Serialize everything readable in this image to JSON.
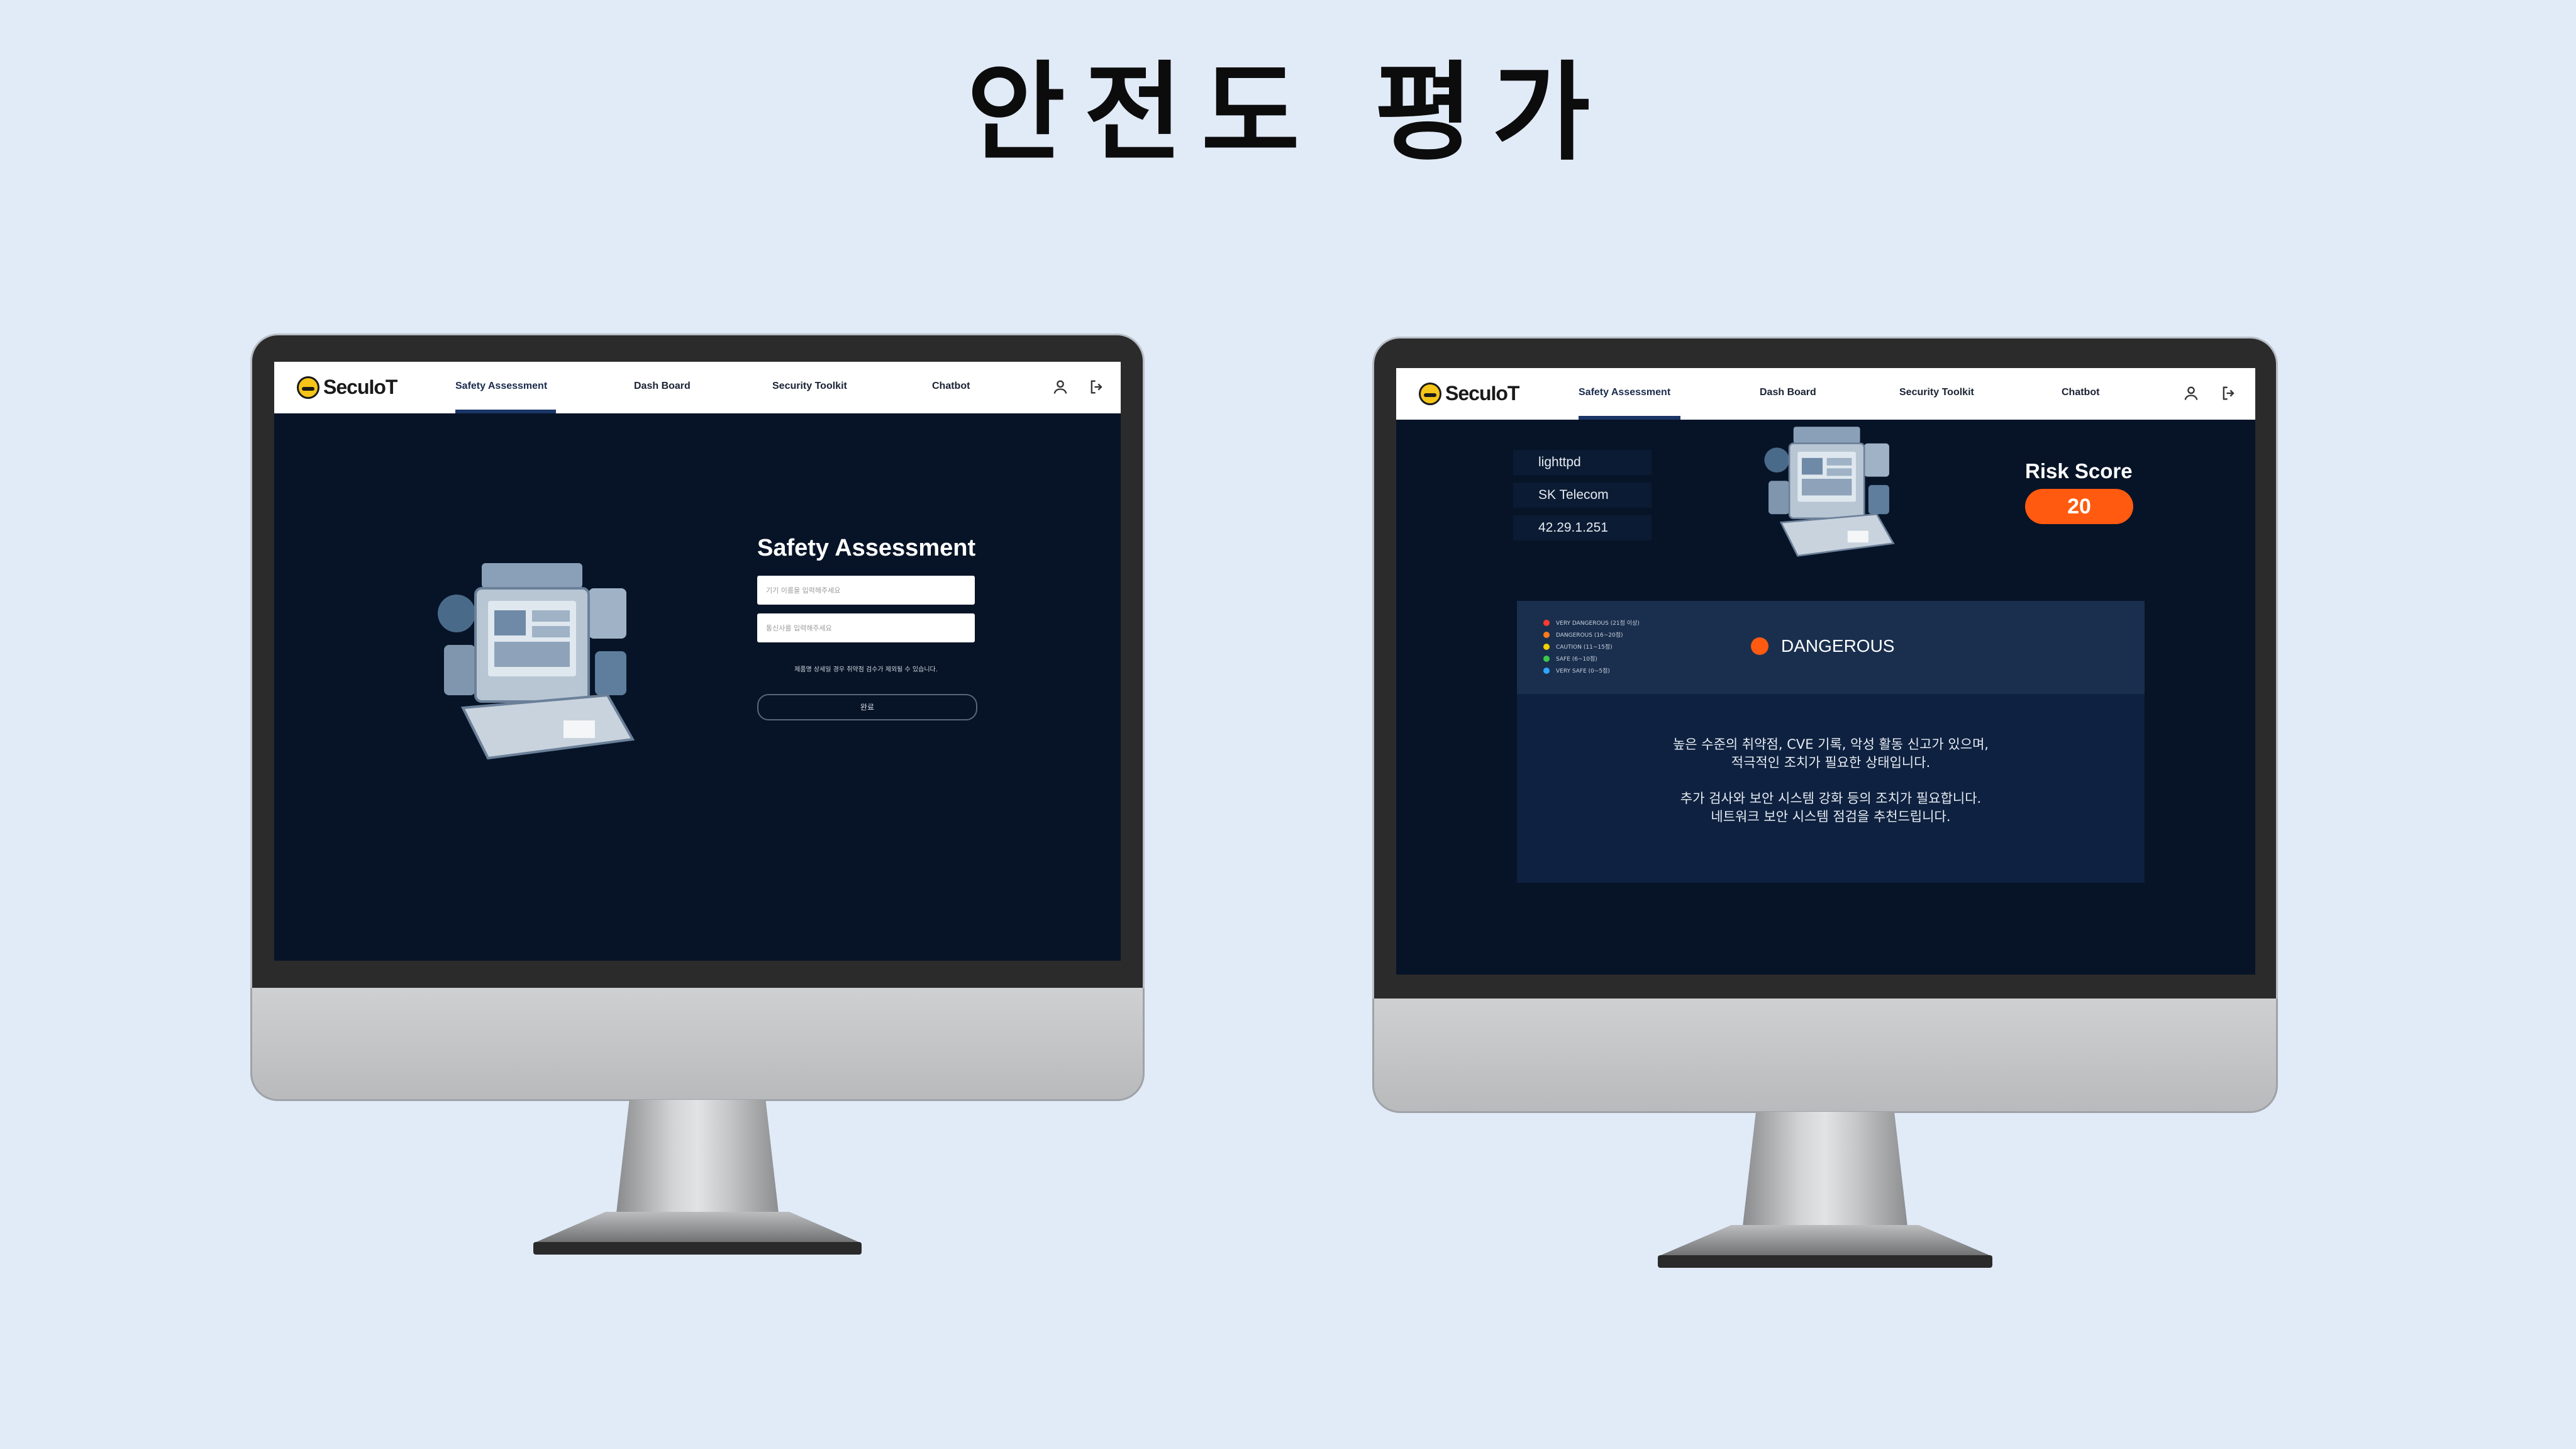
{
  "slide": {
    "title": "안전도 평가"
  },
  "brand": {
    "name": "SecuIoT"
  },
  "nav": {
    "items": [
      "Safety Assessment",
      "Dash Board",
      "Security Toolkit",
      "Chatbot"
    ],
    "active": "Safety Assessment",
    "icons": [
      "user-icon",
      "logout-icon"
    ]
  },
  "left_screen": {
    "panel_title": "Safety Assessment",
    "input_device": {
      "placeholder": "기기 이름을 입력해주세요",
      "value": ""
    },
    "input_carrier": {
      "placeholder": "통신사를 입력해주세요",
      "value": ""
    },
    "hint": "제품명 상세일 경우 취약점 검수가 제외될 수 있습니다.",
    "submit_label": "완료"
  },
  "right_screen": {
    "device_info": [
      "lighttpd",
      "SK Telecom",
      "42.29.1.251"
    ],
    "risk_label": "Risk Score",
    "risk_score": "20",
    "legend": [
      {
        "label": "VERY DANGEROUS (21점 이상)",
        "color": "#ff3b30"
      },
      {
        "label": "DANGEROUS (16~20점)",
        "color": "#ff7a1a"
      },
      {
        "label": "CAUTION (11~15점)",
        "color": "#f5d000"
      },
      {
        "label": "SAFE (6~10점)",
        "color": "#3cc84a"
      },
      {
        "label": "VERY SAFE (0~5점)",
        "color": "#2ea6ff"
      }
    ],
    "status": {
      "label": "DANGEROUS",
      "color": "#ff5a0f"
    },
    "description": [
      "높은 수준의 취약점, CVE 기록, 악성 활동 신고가 있으며,",
      "적극적인 조치가 필요한 상태입니다.",
      "추가 검사와 보안 시스템 강화 등의 조치가 필요합니다.",
      "네트워크 보안 시스템 점검을 추천드립니다."
    ]
  }
}
